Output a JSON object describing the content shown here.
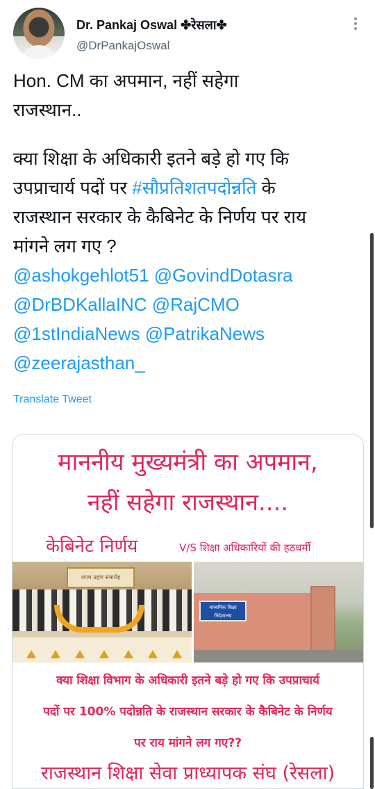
{
  "author": {
    "name": "Dr. Pankaj Oswal ✤रेसला✤",
    "handle": "@DrPankajOswal"
  },
  "tweet": {
    "lines": [
      "Hon. CM का अपमान, नहीं सहेगा",
      "राजस्थान..",
      "",
      "क्या शिक्षा के अधिकारी इतने बड़े हो गए कि",
      "उपप्राचार्य पदों पर #सौप्रतिशतपदोन्नति के",
      "राजस्थान सरकार के कैबिनेट के निर्णय पर राय",
      "मांगने लग गए ?",
      "@ashokgehlot51 @GovindDotasra",
      "@DrBDKallaINC @RajCMO",
      "@1stIndiaNews @PatrikaNews",
      "@zeerajasthan_"
    ],
    "line4_pre": "उपप्राचार्य पदों पर ",
    "hashtag": "#सौप्रतिशतपदोन्नति",
    "line4_post": " के",
    "translate_label": "Translate Tweet"
  },
  "poster": {
    "title_line1": "माननीय मुख्यमंत्री का अपमान,",
    "title_line2": "नहीं सहेगा राजस्थान....",
    "sub_left": "केबिनेट निर्णय",
    "sub_right": "V/S शिक्षा अधिकारियों की हठधर्मी",
    "banner_text": "शपथ ग्रहण समारोह",
    "sign_text": "माध्यमिक शिक्षा निदेशालय",
    "body_line1": "क्या शिक्षा विभाग के अधिकारी इतने बड़े हो गए कि उपप्राचार्य",
    "body_line2": "पदों पर 100% पदोन्नति के राजस्थान सरकार के कैबिनेट के निर्णय",
    "body_line3": "पर राय मांगने लग गए??",
    "footer": "राजस्थान शिक्षा सेवा प्राध्यापक संघ (रेसला)"
  },
  "icons": {
    "more": "more-vertical-icon"
  },
  "colors": {
    "link": "#1d9bf0",
    "poster_accent": "#e0265a"
  }
}
